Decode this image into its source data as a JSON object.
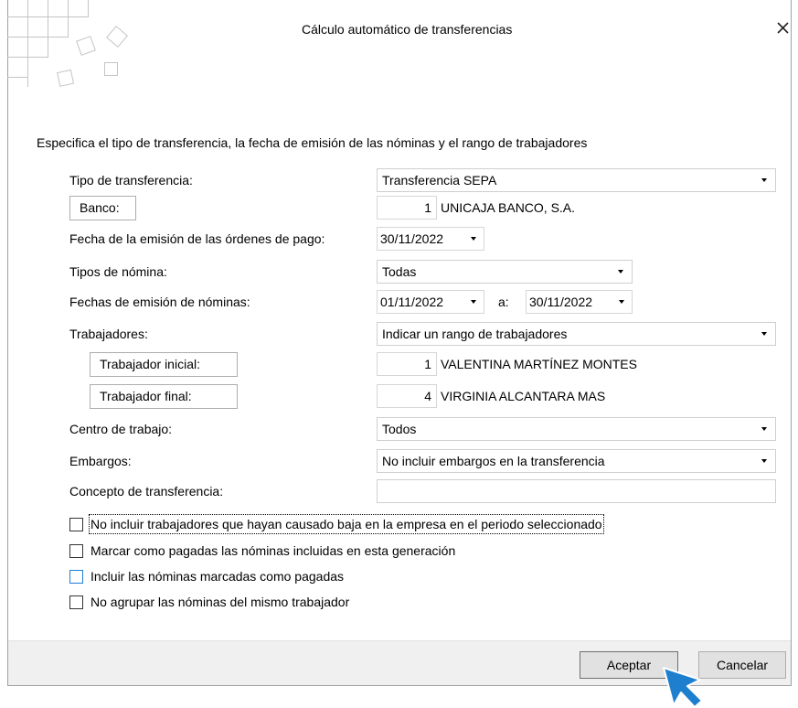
{
  "dialog": {
    "title": "Cálculo automático de transferencias",
    "close_icon": "close-icon",
    "logo_icon": "decorative-squares-logo"
  },
  "instructions": "Especifica el tipo de transferencia, la fecha de emisión de las nóminas y el rango de trabajadores",
  "form": {
    "tipo_transferencia": {
      "label": "Tipo de transferencia:",
      "value": "Transferencia SEPA"
    },
    "banco": {
      "button": "Banco:",
      "code": "1",
      "name": "UNICAJA BANCO, S.A."
    },
    "fecha_ordenes": {
      "label": "Fecha de la emisión de las órdenes de pago:",
      "value": "30/11/2022"
    },
    "tipos_nomina": {
      "label": "Tipos de nómina:",
      "value": "Todas"
    },
    "fechas_emision": {
      "label": "Fechas de emisión de nóminas:",
      "from": "01/11/2022",
      "separator": "a:",
      "to": "30/11/2022"
    },
    "trabajadores": {
      "label": "Trabajadores:",
      "value": "Indicar un rango de trabajadores"
    },
    "trabajador_inicial": {
      "button": "Trabajador inicial:",
      "code": "1",
      "name": "VALENTINA MARTÍNEZ MONTES"
    },
    "trabajador_final": {
      "button": "Trabajador final:",
      "code": "4",
      "name": "VIRGINIA ALCANTARA MAS"
    },
    "centro_trabajo": {
      "label": "Centro de trabajo:",
      "value": "Todos"
    },
    "embargos": {
      "label": "Embargos:",
      "value": "No incluir embargos en la transferencia"
    },
    "concepto": {
      "label": "Concepto de transferencia:",
      "value": ""
    }
  },
  "options": [
    {
      "label": "No incluir trabajadores que hayan causado baja en la empresa en el periodo seleccionado",
      "checked": false,
      "focused": true
    },
    {
      "label": "Marcar como pagadas las nóminas incluidas en esta generación",
      "checked": false
    },
    {
      "label": "Incluir las nóminas marcadas como pagadas",
      "checked": false,
      "highlighted": true
    },
    {
      "label": "No agrupar las nóminas del mismo trabajador",
      "checked": false
    }
  ],
  "footer": {
    "accept_label": "Aceptar",
    "cancel_label": "Cancelar"
  },
  "icons": {
    "close": "close-icon",
    "dropdown": "dropdown-arrow-icon",
    "pointer": "mouse-pointer-icon"
  },
  "colors": {
    "accent": "#1c7fd6",
    "pointer": "#1f7fcf",
    "border": "#a0a0a0",
    "footer_bg": "#f0f0f0",
    "text": "#000000"
  }
}
